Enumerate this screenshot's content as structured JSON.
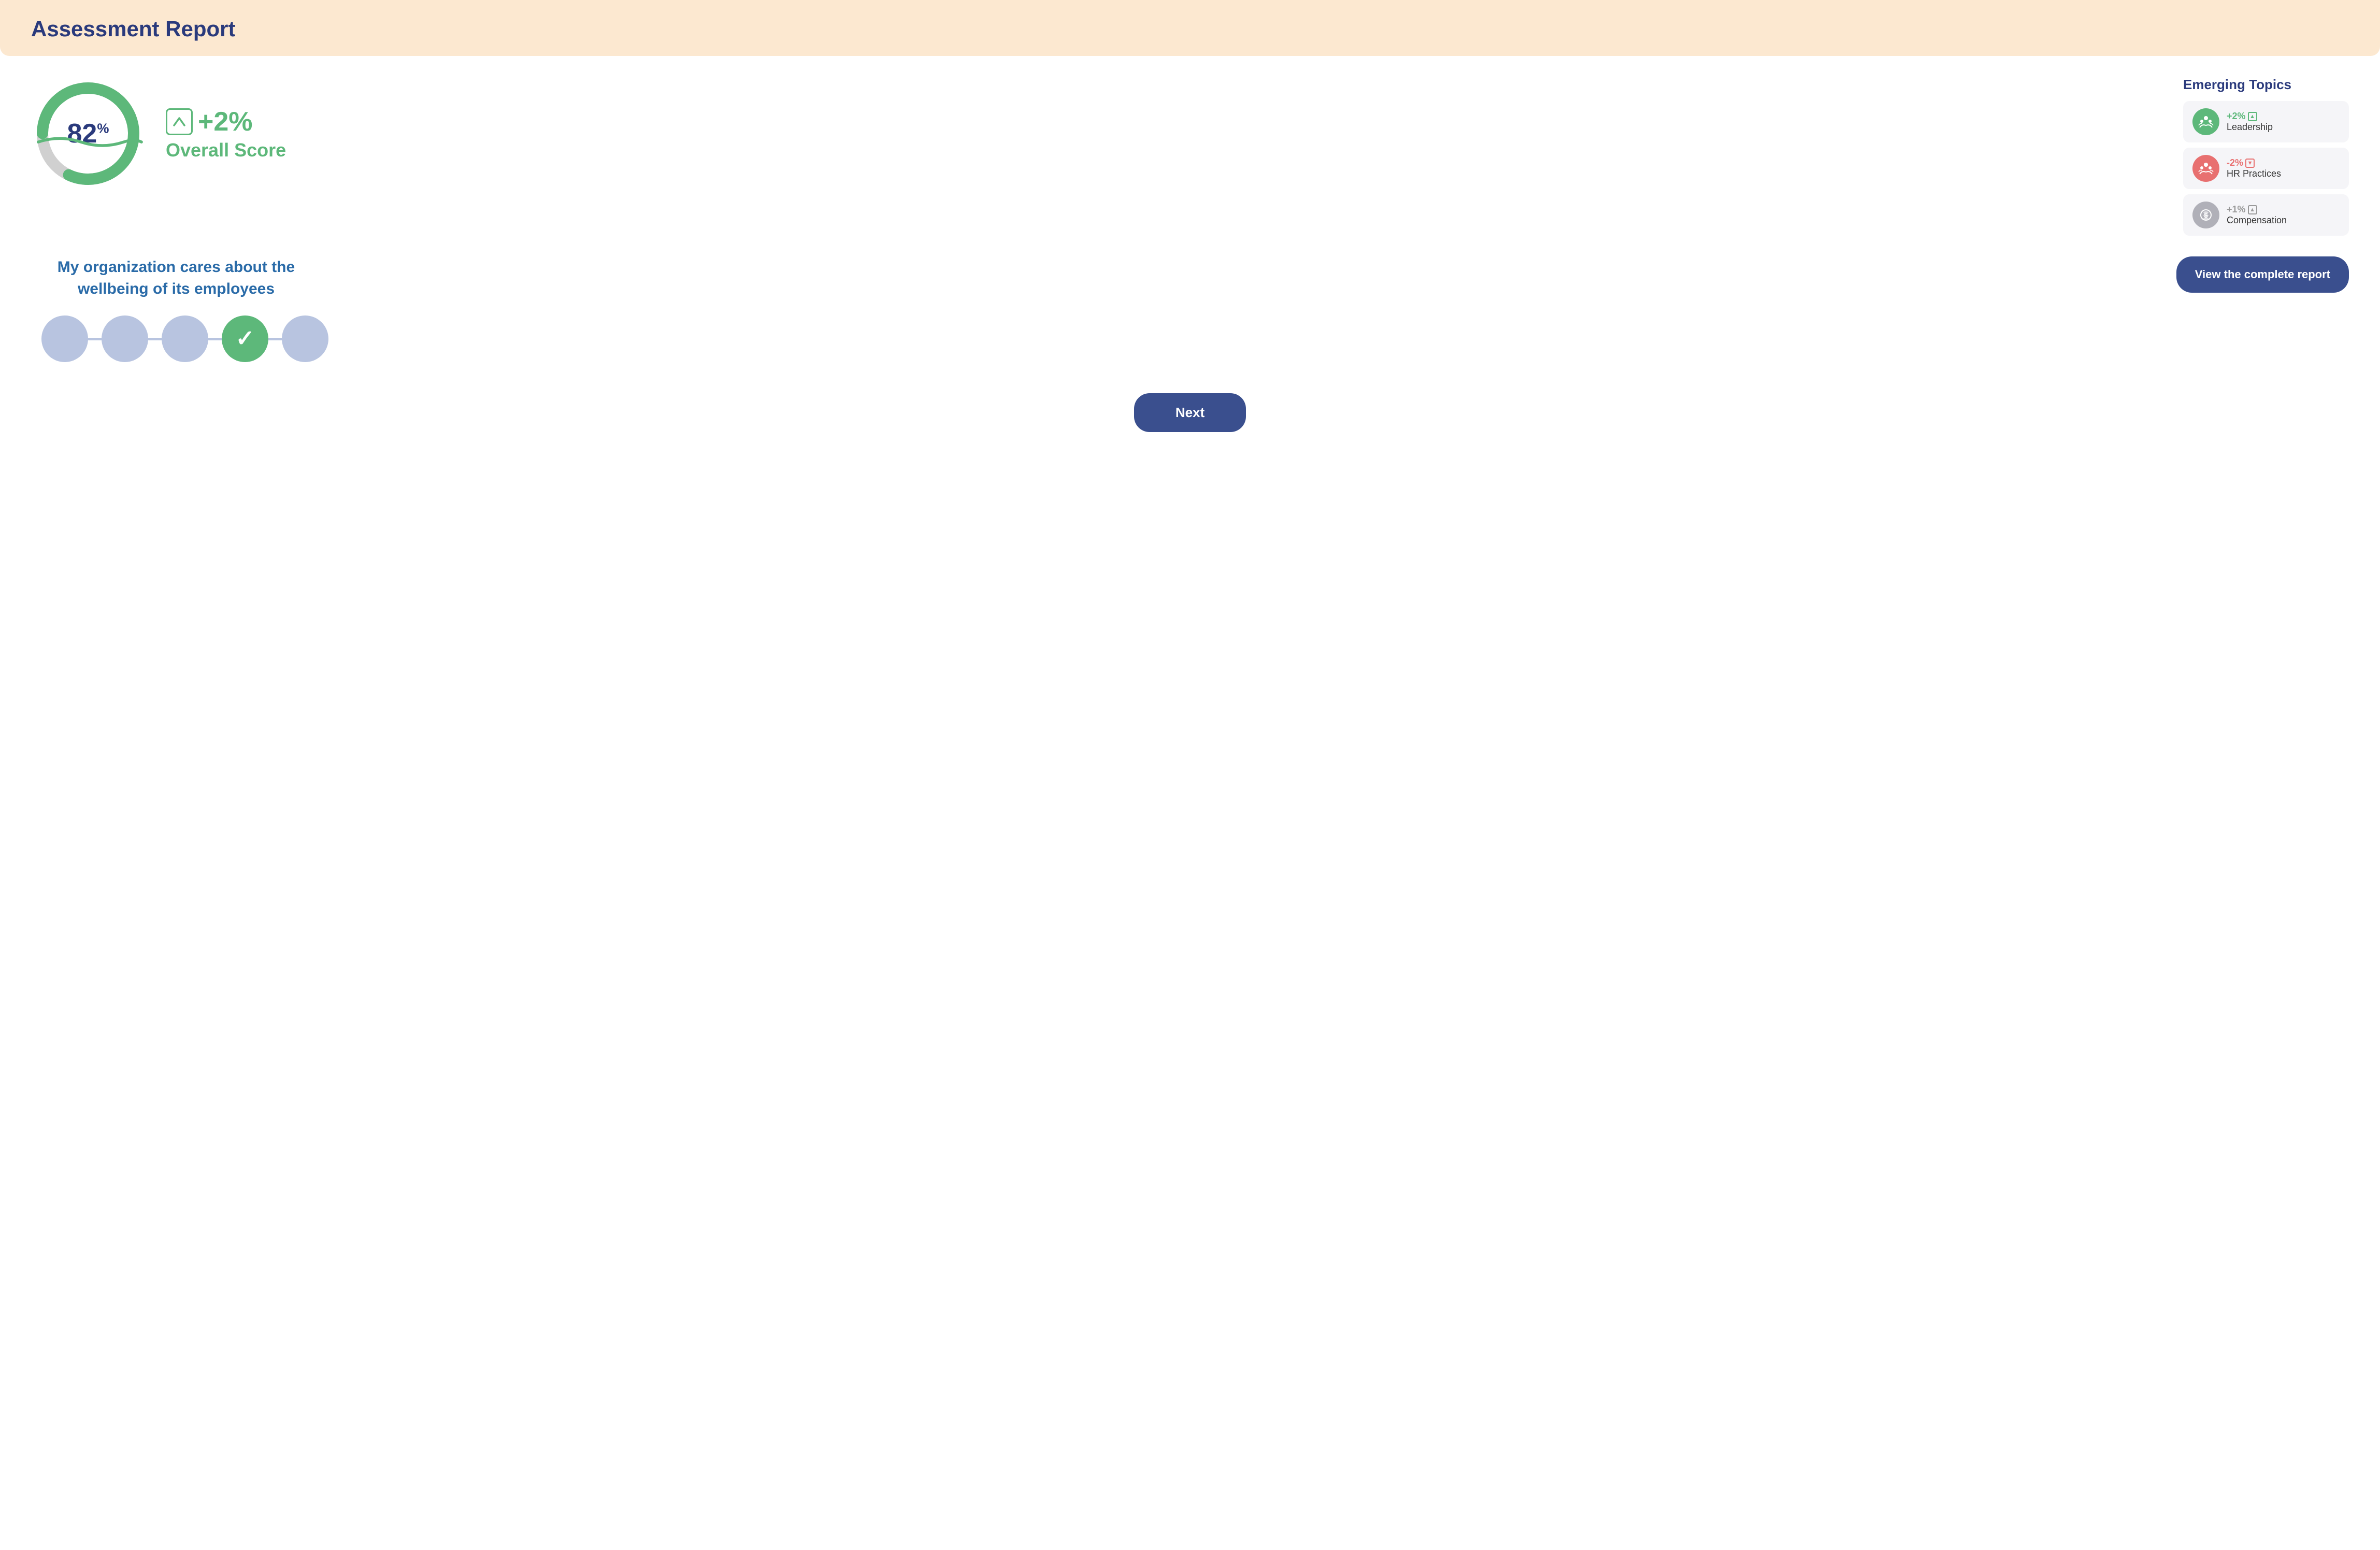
{
  "header": {
    "title": "Assessment Report",
    "bg_color": "#fce8d0"
  },
  "score": {
    "value": "82",
    "unit": "%",
    "change": "+2%",
    "label": "Overall Score"
  },
  "emerging": {
    "title": "Emerging Topics",
    "items": [
      {
        "name": "Leadership",
        "change": "+2%",
        "direction": "up",
        "color": "green",
        "icon": "👥"
      },
      {
        "name": "HR Practices",
        "change": "-2%",
        "direction": "down",
        "color": "red",
        "icon": "👥"
      },
      {
        "name": "Compensation",
        "change": "+1%",
        "direction": "up",
        "color": "gray",
        "icon": "💰"
      }
    ]
  },
  "question": {
    "text": "My organization cares about the wellbeing of its employees"
  },
  "scale": {
    "dots": [
      1,
      2,
      3,
      4,
      5
    ],
    "selected": 4
  },
  "buttons": {
    "view_report": "View the complete report",
    "next": "Next"
  }
}
